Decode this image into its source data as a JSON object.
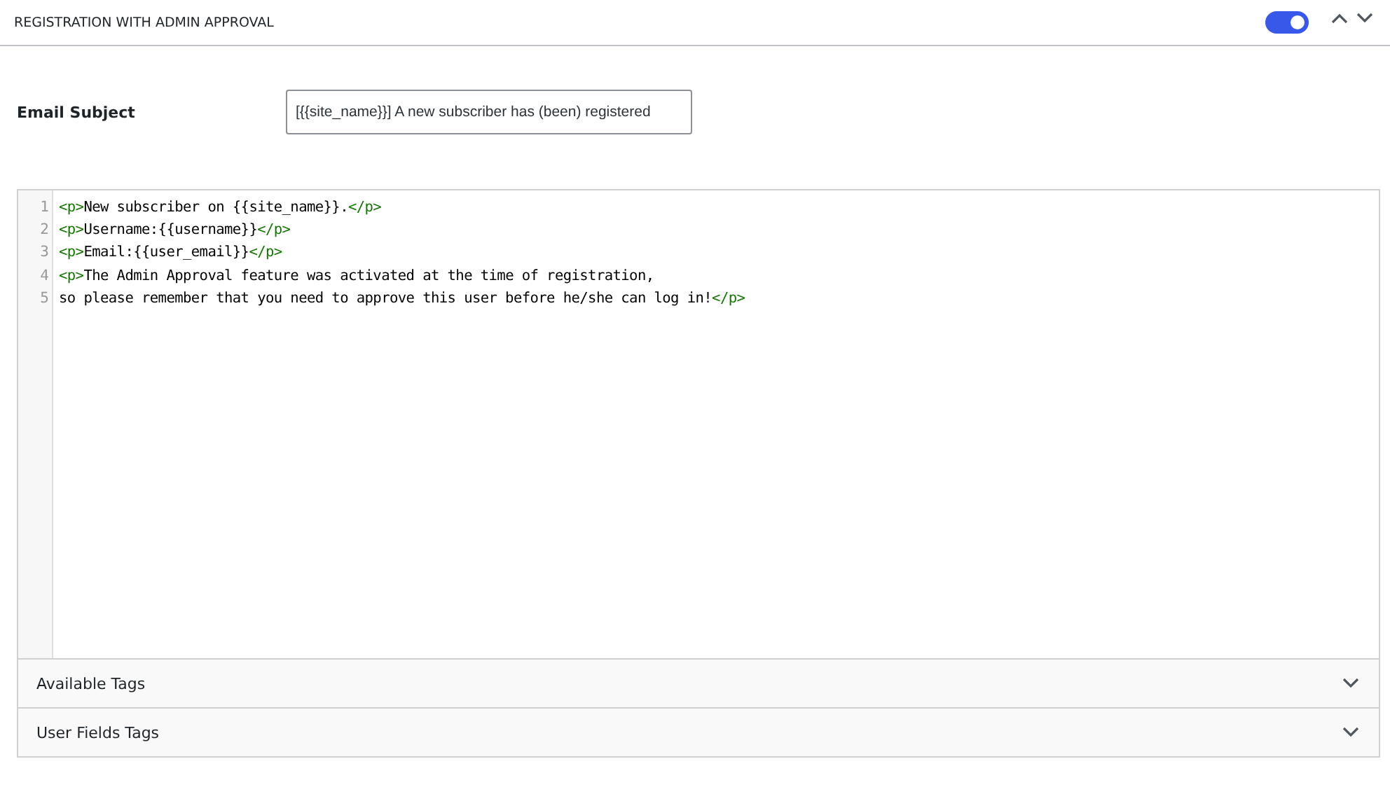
{
  "panel": {
    "title": "REGISTRATION WITH ADMIN APPROVAL",
    "enabled": true
  },
  "email_subject": {
    "label": "Email Subject",
    "value": "[{{site_name}}] A new subscriber has (been) registered"
  },
  "editor": {
    "lines": [
      {
        "number": "1",
        "segments": [
          {
            "kind": "tag",
            "text": "<p>"
          },
          {
            "kind": "text",
            "text": "New subscriber on {{site_name}}."
          },
          {
            "kind": "tag",
            "text": "</p>"
          }
        ]
      },
      {
        "number": "2",
        "segments": [
          {
            "kind": "tag",
            "text": "<p>"
          },
          {
            "kind": "text",
            "text": "Username:{{username}}"
          },
          {
            "kind": "tag",
            "text": "</p>"
          }
        ]
      },
      {
        "number": "3",
        "segments": [
          {
            "kind": "tag",
            "text": "<p>"
          },
          {
            "kind": "text",
            "text": "Email:{{user_email}}"
          },
          {
            "kind": "tag",
            "text": "</p>"
          }
        ]
      },
      {
        "number": "4",
        "segments": [
          {
            "kind": "tag",
            "text": "<p>"
          },
          {
            "kind": "text",
            "text": "The Admin Approval feature was activated at the time of registration,"
          }
        ]
      },
      {
        "number": "5",
        "segments": [
          {
            "kind": "text",
            "text": "so please remember that you need to approve this user before he/she can log in!"
          },
          {
            "kind": "tag",
            "text": "</p>"
          }
        ]
      }
    ]
  },
  "sections": [
    {
      "label": "Available Tags",
      "expanded": false
    },
    {
      "label": "User Fields Tags",
      "expanded": false
    }
  ]
}
